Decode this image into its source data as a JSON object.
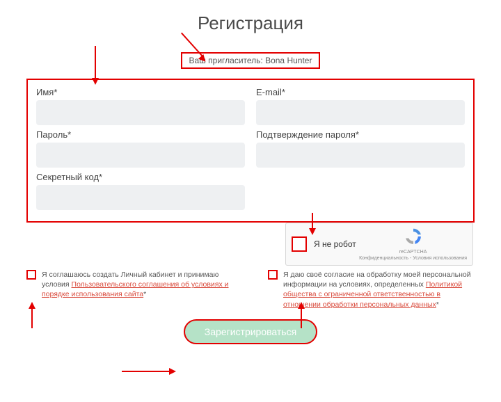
{
  "title": "Регистрация",
  "inviter_line": "Ваш пригласитель: Bona Hunter",
  "fields": {
    "name_label": "Имя*",
    "email_label": "E-mail*",
    "password_label": "Пароль*",
    "password_confirm_label": "Подтверждение пароля*",
    "secret_label": "Секретный код*"
  },
  "captcha": {
    "label": "Я не робот",
    "brand": "reCAPTCHA",
    "legal": "Конфиденциальность - Условия использования"
  },
  "consents": {
    "left_prefix": "Я соглашаюсь создать Личный кабинет и принимаю условия ",
    "left_link": "Пользовательского соглашения об условиях и порядке использования сайта",
    "left_suffix": "*",
    "right_prefix": "Я даю своё согласие на обработку моей персональной информации на условиях, определенных ",
    "right_link": "Политикой общества с ограниченной ответственностью в отношении обработки персональных данных",
    "right_suffix": "*"
  },
  "submit_label": "Зарегистрироваться"
}
